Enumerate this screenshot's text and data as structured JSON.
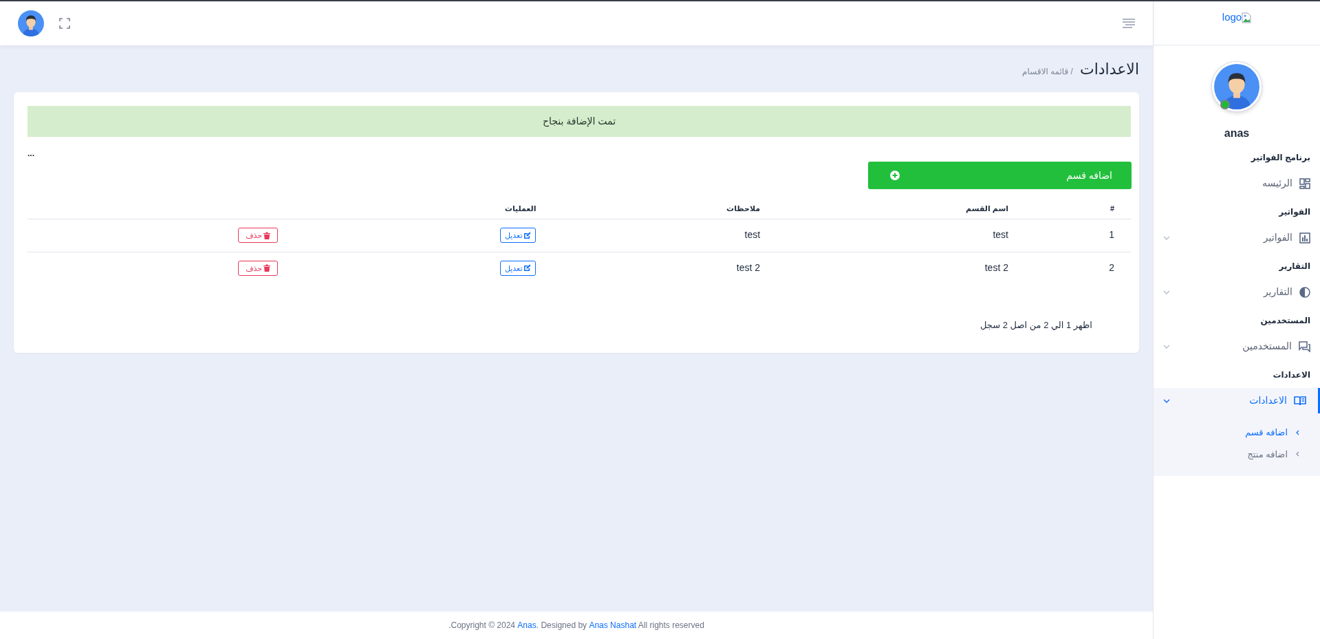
{
  "logo": {
    "text": "logo"
  },
  "user": {
    "name": "anas",
    "online": true
  },
  "sidebar": {
    "sections": [
      {
        "heading": "برنامج الفواتير",
        "items": [
          {
            "label": "الرئيسه",
            "kind": "link",
            "selected": false
          }
        ]
      },
      {
        "heading": "الفواتير",
        "items": [
          {
            "label": "الفواتير",
            "kind": "menu",
            "selected": false,
            "expanded": false
          }
        ]
      },
      {
        "heading": "التقارير",
        "items": [
          {
            "label": "التقارير",
            "kind": "menu",
            "selected": false,
            "expanded": false
          }
        ]
      },
      {
        "heading": "المستخدمين",
        "items": [
          {
            "label": "المستخدمين",
            "kind": "menu",
            "selected": false,
            "expanded": false
          }
        ]
      },
      {
        "heading": "الاعدادات",
        "items": [
          {
            "label": "الاعدادات",
            "kind": "menu",
            "selected": true,
            "expanded": true,
            "children": [
              {
                "label": "اضافه قسم",
                "selected": true
              },
              {
                "label": "اضافه منتج",
                "selected": false
              }
            ]
          }
        ]
      }
    ]
  },
  "page": {
    "title": "الاعدادات",
    "breadcrumb": "/ قائمه الاقسام"
  },
  "alert": {
    "text": "تمت الإضافة بنجاح"
  },
  "dots": "...",
  "add_button": {
    "label": "اضافه قسم"
  },
  "table": {
    "columns": [
      "#",
      "اسم القسم",
      "ملاحظات",
      "العمليات"
    ],
    "rows": [
      {
        "cells": [
          "1",
          "test",
          "test"
        ],
        "edit": "تعديل",
        "delete": "حذف"
      },
      {
        "cells": [
          "2",
          "test 2",
          "test 2"
        ],
        "edit": "تعديل",
        "delete": "حذف"
      }
    ]
  },
  "pagination_info": "اظهر 1 الي 2 من اصل 2 سجل",
  "footer": {
    "parts": [
      {
        "kind": "text",
        "text": " All rights reserved"
      },
      {
        "kind": "link",
        "text": "Anas Nashat"
      },
      {
        "kind": "text",
        "text": ". Designed by "
      },
      {
        "kind": "link",
        "text": "Anas"
      },
      {
        "kind": "text",
        "text": ".Copyright © 2024 "
      }
    ]
  }
}
